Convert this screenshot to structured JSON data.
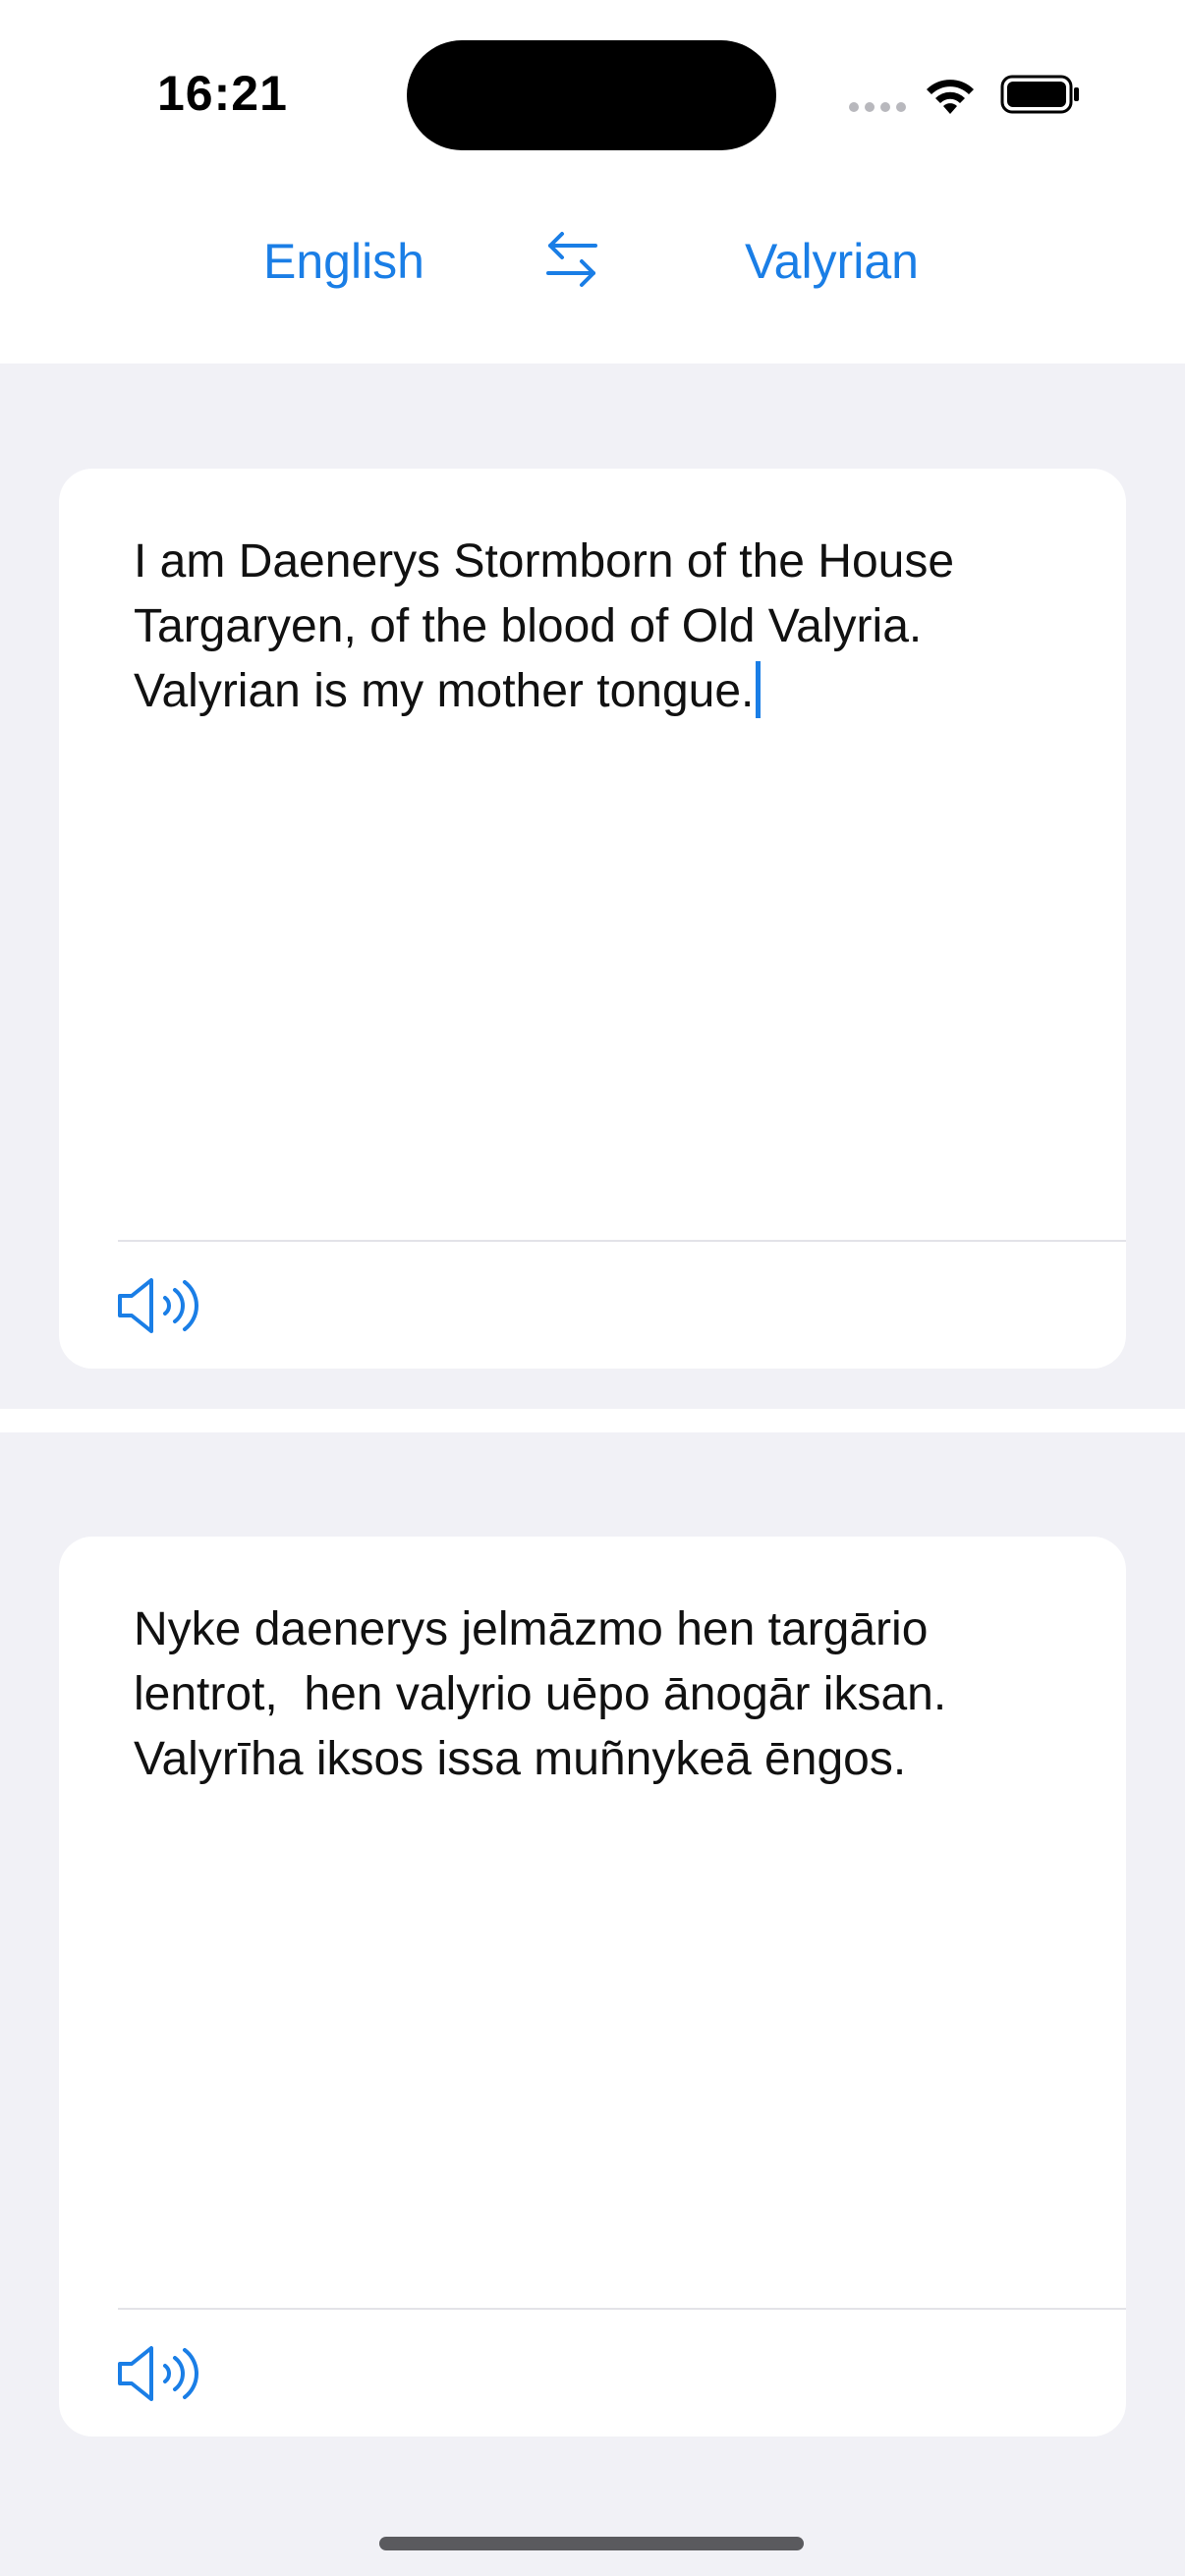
{
  "status_bar": {
    "time": "16:21",
    "icons": [
      "cellular-signal-icon",
      "wifi-icon",
      "battery-icon"
    ]
  },
  "header": {
    "source_language": "English",
    "target_language": "Valyrian",
    "swap_icon": "swap-arrows-icon"
  },
  "source_card": {
    "text": "I am Daenerys Stormborn of the House Targaryen, of the blood of Old Valyria. Valyrian is my mother tongue.",
    "speak_icon": "speaker-icon"
  },
  "target_card": {
    "text": "Nyke daenerys jelmāzmo hen targārio lentrot,  hen valyrio uēpo ānogār iksan. Valyrīha iksos issa muñnykeā ēngos.",
    "speak_icon": "speaker-icon"
  },
  "colors": {
    "accent": "#1a7ee6",
    "background": "#f1f1f6",
    "card": "#ffffff",
    "text": "#111111"
  }
}
